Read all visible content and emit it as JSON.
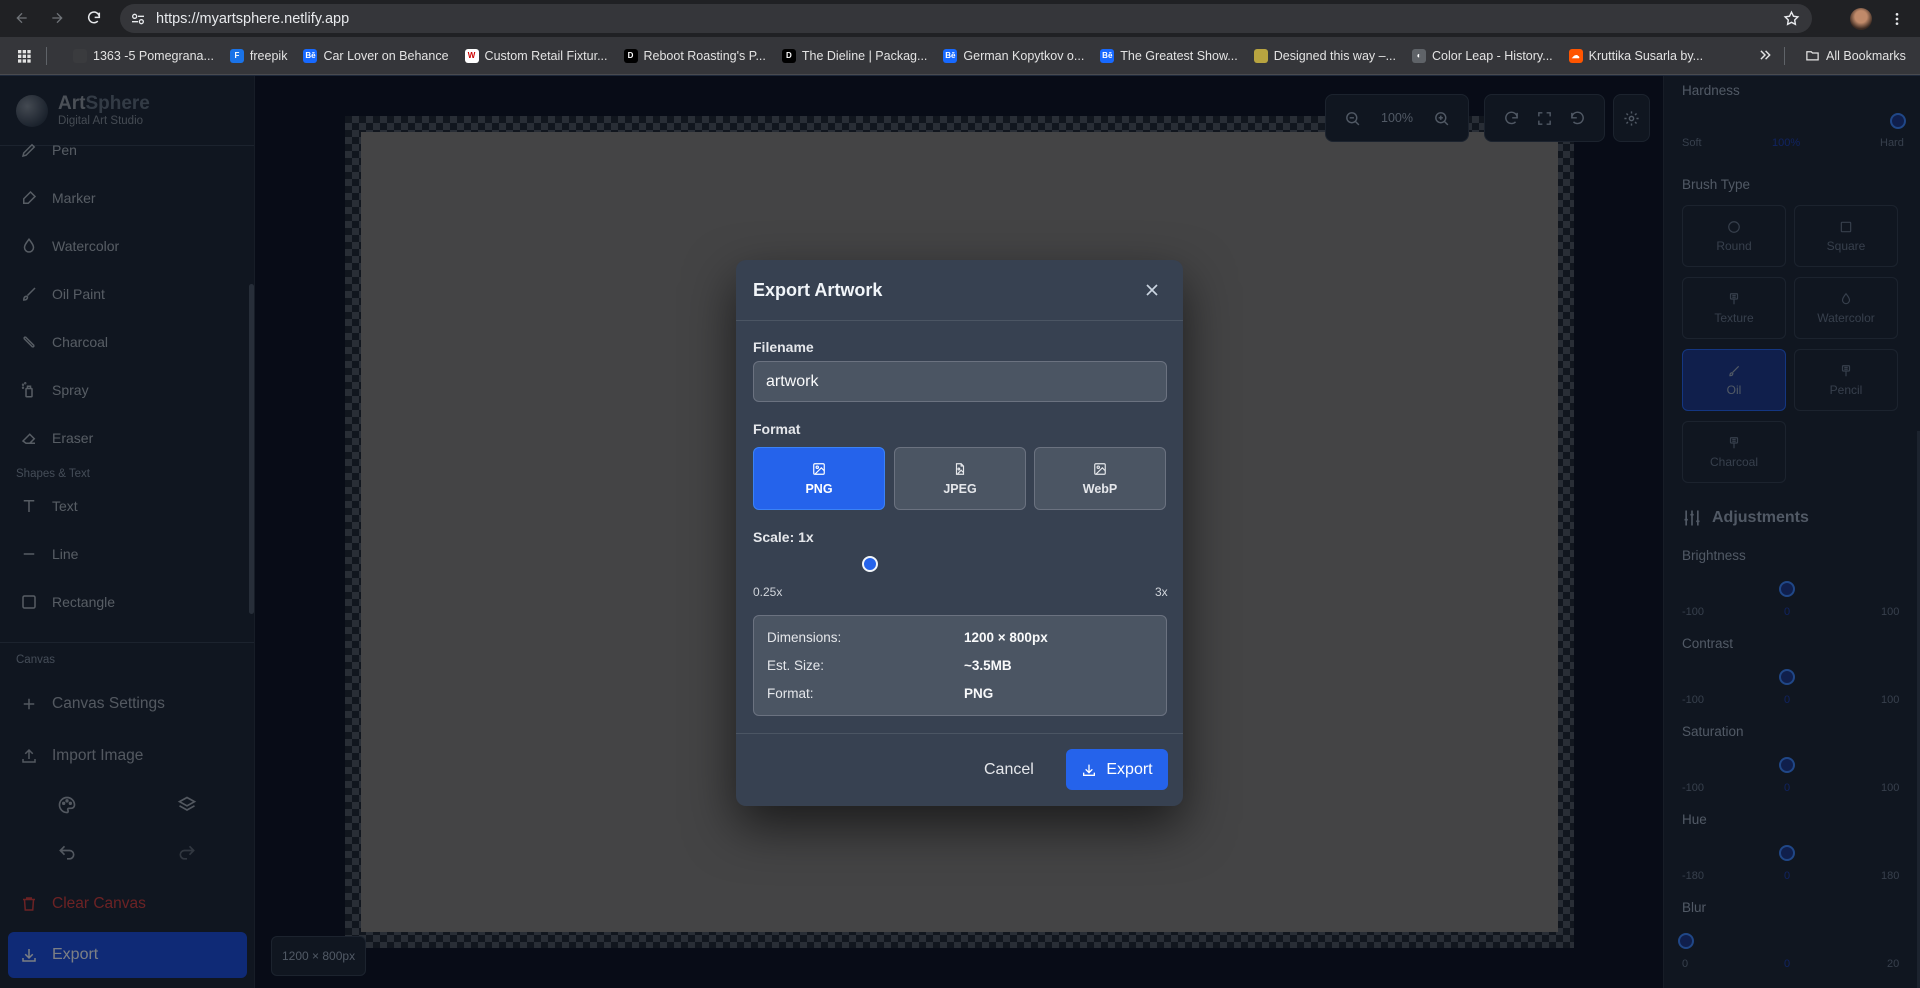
{
  "browser": {
    "url": "https://myartsphere.netlify.app",
    "bookmarks": [
      {
        "label": "1363 -5 Pomegrana...",
        "color": "#3a3b3e",
        "glyph": ""
      },
      {
        "label": "freepik",
        "color": "#1a73e8",
        "glyph": "F"
      },
      {
        "label": "Car Lover on Behance",
        "color": "#1769ff",
        "glyph": "Bē"
      },
      {
        "label": "Custom Retail Fixtur...",
        "color": "#ffffff",
        "glyph": "W"
      },
      {
        "label": "Reboot Roasting's P...",
        "color": "#000000",
        "glyph": "D"
      },
      {
        "label": "The Dieline | Packag...",
        "color": "#000000",
        "glyph": "D"
      },
      {
        "label": "German Kopytkov o...",
        "color": "#1769ff",
        "glyph": "Bē"
      },
      {
        "label": "The Greatest Show...",
        "color": "#1769ff",
        "glyph": "Bē"
      },
      {
        "label": "Designed this way –...",
        "color": "#b8a440",
        "glyph": ""
      },
      {
        "label": "Color Leap - History...",
        "color": "#5f6368",
        "glyph": "◐"
      },
      {
        "label": "Kruttika Susarla by...",
        "color": "#ff5500",
        "glyph": "☁"
      }
    ],
    "all_bookmarks": "All Bookmarks"
  },
  "app": {
    "name_art": "Art",
    "name_sphere": "Sphere",
    "subtitle": "Digital Art Studio"
  },
  "tools": [
    {
      "label": "Pen",
      "icon": "pen-icon"
    },
    {
      "label": "Marker",
      "icon": "marker-icon"
    },
    {
      "label": "Watercolor",
      "icon": "droplet-icon"
    },
    {
      "label": "Oil Paint",
      "icon": "paintbrush-icon"
    },
    {
      "label": "Charcoal",
      "icon": "charcoal-icon"
    },
    {
      "label": "Spray",
      "icon": "spray-icon"
    },
    {
      "label": "Eraser",
      "icon": "eraser-icon"
    }
  ],
  "shapes_section": "Shapes & Text",
  "shapes": [
    {
      "label": "Text",
      "icon": "text-icon"
    },
    {
      "label": "Line",
      "icon": "line-icon"
    },
    {
      "label": "Rectangle",
      "icon": "rectangle-icon"
    }
  ],
  "canvas_section": "Canvas",
  "canvas_settings": "Canvas Settings",
  "import_image": "Import Image",
  "clear_canvas": "Clear Canvas",
  "export_label": "Export",
  "canvas": {
    "zoom": "100%",
    "size_label": "1200 × 800px"
  },
  "right_panel": {
    "hardness_label": "Hardness",
    "hardness_value": "100%",
    "soft": "Soft",
    "hard": "Hard",
    "brush_type_label": "Brush Type",
    "brushes": [
      {
        "label": "Round",
        "icon": "circle-icon"
      },
      {
        "label": "Square",
        "icon": "square-icon"
      },
      {
        "label": "Texture",
        "icon": "texture-brush-icon"
      },
      {
        "label": "Watercolor",
        "icon": "droplet-icon"
      },
      {
        "label": "Oil",
        "icon": "brush-icon"
      },
      {
        "label": "Pencil",
        "icon": "pencil-brush-icon"
      },
      {
        "label": "Charcoal",
        "icon": "charcoal-brush-icon"
      }
    ],
    "active_brush": "Oil",
    "adjustments_label": "Adjustments",
    "adjustments": [
      {
        "label": "Brightness",
        "min": "-100",
        "value": "0",
        "max": "100"
      },
      {
        "label": "Contrast",
        "min": "-100",
        "value": "0",
        "max": "100"
      },
      {
        "label": "Saturation",
        "min": "-100",
        "value": "0",
        "max": "100"
      },
      {
        "label": "Hue",
        "min": "-180",
        "value": "0",
        "max": "180"
      },
      {
        "label": "Blur",
        "min": "0",
        "value": "0",
        "max": "20"
      }
    ]
  },
  "modal": {
    "title": "Export Artwork",
    "filename_label": "Filename",
    "filename_value": "artwork",
    "format_label": "Format",
    "formats": [
      "PNG",
      "JPEG",
      "WebP"
    ],
    "selected_format": "PNG",
    "scale_label": "Scale: 1x",
    "scale_min": "0.25x",
    "scale_max": "3x",
    "scale_value": 1,
    "info": [
      {
        "key": "Dimensions:",
        "value": "1200 × 800px"
      },
      {
        "key": "Est. Size:",
        "value": "~3.5MB"
      },
      {
        "key": "Format:",
        "value": "PNG"
      }
    ],
    "cancel": "Cancel",
    "export": "Export"
  },
  "colors": {
    "accent": "#2563eb",
    "danger": "#ef4444",
    "panel": "#1e293b",
    "modal": "#374151"
  }
}
